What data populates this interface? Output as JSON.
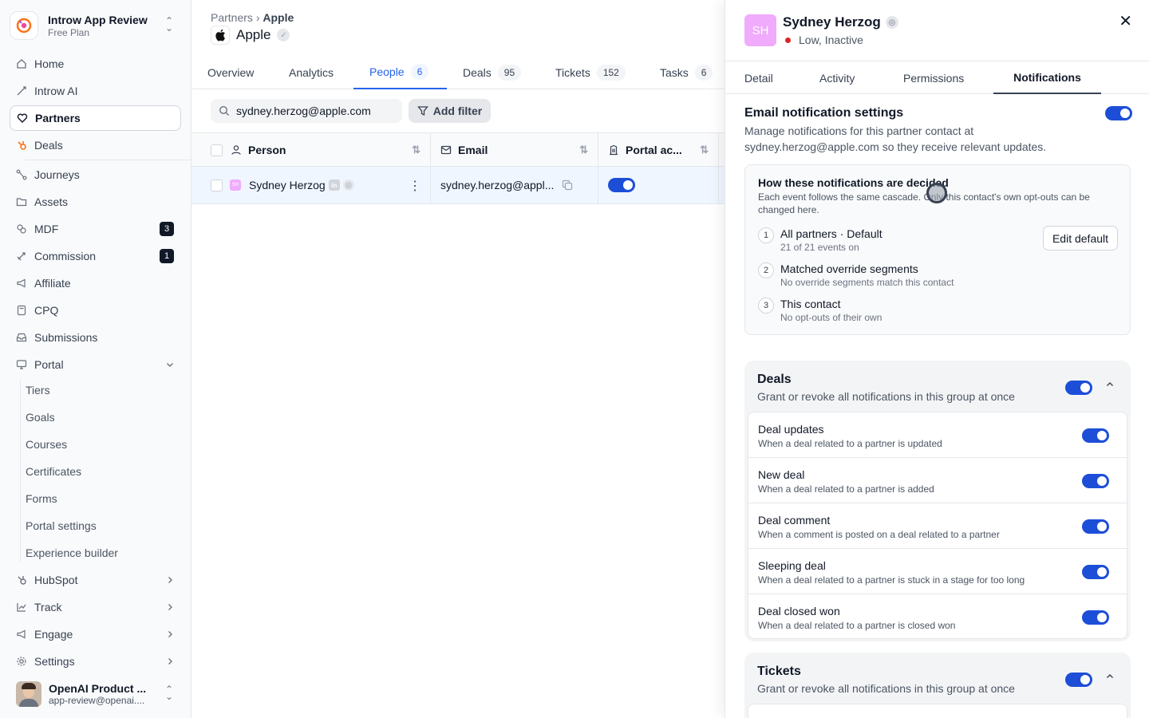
{
  "workspace": {
    "name": "Introw App Review",
    "plan": "Free Plan"
  },
  "sidebar": {
    "items": [
      {
        "label": "Home",
        "icon": "home-icon"
      },
      {
        "label": "Introw AI",
        "icon": "sparkle-icon"
      },
      {
        "label": "Partners",
        "icon": "handshake-icon",
        "active": true
      },
      {
        "label": "Deals",
        "icon": "hubspot-icon"
      },
      {
        "label": "Journeys",
        "icon": "journey-icon"
      },
      {
        "label": "Assets",
        "icon": "folder-icon"
      },
      {
        "label": "MDF",
        "icon": "coins-icon",
        "badge": "3"
      },
      {
        "label": "Commission",
        "icon": "rocket-icon",
        "badge": "1"
      },
      {
        "label": "Affiliate",
        "icon": "megaphone-icon"
      },
      {
        "label": "CPQ",
        "icon": "calculator-icon"
      },
      {
        "label": "Submissions",
        "icon": "inbox-icon"
      },
      {
        "label": "Portal",
        "icon": "monitor-icon"
      }
    ],
    "portal_sub": [
      "Tiers",
      "Goals",
      "Courses",
      "Certificates",
      "Forms",
      "Portal settings",
      "Experience builder"
    ],
    "bottom": [
      {
        "label": "HubSpot",
        "icon": "hubspot-icon"
      },
      {
        "label": "Track",
        "icon": "chart-icon"
      },
      {
        "label": "Engage",
        "icon": "megaphone-icon"
      },
      {
        "label": "Settings",
        "icon": "gear-icon"
      }
    ],
    "user": {
      "name": "OpenAI Product ...",
      "email": "app-review@openai...."
    }
  },
  "main": {
    "breadcrumb": {
      "parent": "Partners",
      "current": "Apple"
    },
    "title": "Apple",
    "tabs": [
      {
        "label": "Overview"
      },
      {
        "label": "Analytics"
      },
      {
        "label": "People",
        "count": "6",
        "active": true
      },
      {
        "label": "Deals",
        "count": "95"
      },
      {
        "label": "Tickets",
        "count": "152"
      },
      {
        "label": "Tasks",
        "count": "6"
      }
    ],
    "search_value": "sydney.herzog@apple.com",
    "add_filter": "Add filter",
    "columns": [
      "Person",
      "Email",
      "Portal ac..."
    ],
    "row": {
      "person": "Sydney Herzog",
      "initials": "SH",
      "email": "sydney.herzog@appl...",
      "portal_access": true
    }
  },
  "panel": {
    "initials": "SH",
    "name": "Sydney Herzog",
    "status": "Low, Inactive",
    "tabs": [
      "Detail",
      "Activity",
      "Permissions",
      "Notifications"
    ],
    "active_tab": "Notifications",
    "email_settings": {
      "title": "Email notification settings",
      "description": "Manage notifications for this partner contact at sydney.herzog@apple.com so they receive relevant updates.",
      "enabled": true
    },
    "cascade": {
      "title": "How these notifications are decided",
      "description": "Each event follows the same cascade. Only this contact's own opt-outs can be changed here.",
      "steps": [
        {
          "num": "1",
          "title": "All partners · Default",
          "sub": "21 of 21 events on"
        },
        {
          "num": "2",
          "title": "Matched override segments",
          "sub": "No override segments match this contact"
        },
        {
          "num": "3",
          "title": "This contact",
          "sub": "No opt-outs of their own"
        }
      ],
      "edit_label": "Edit default"
    },
    "groups": [
      {
        "title": "Deals",
        "description": "Grant or revoke all notifications in this group at once",
        "enabled": true,
        "events": [
          {
            "title": "Deal updates",
            "sub": "When a deal related to a partner is updated",
            "enabled": true
          },
          {
            "title": "New deal",
            "sub": "When a deal related to a partner is added",
            "enabled": true
          },
          {
            "title": "Deal comment",
            "sub": "When a comment is posted on a deal related to a partner",
            "enabled": true
          },
          {
            "title": "Sleeping deal",
            "sub": "When a deal related to a partner is stuck in a stage for too long",
            "enabled": true
          },
          {
            "title": "Deal closed won",
            "sub": "When a deal related to a partner is closed won",
            "enabled": true
          }
        ]
      },
      {
        "title": "Tickets",
        "description": "Grant or revoke all notifications in this group at once",
        "enabled": true,
        "events": []
      }
    ]
  },
  "colors": {
    "accent": "#2563eb",
    "toggle_on": "#1d4ed8",
    "avatar_pink": "#f0abfc",
    "status_red": "#dc2626"
  }
}
